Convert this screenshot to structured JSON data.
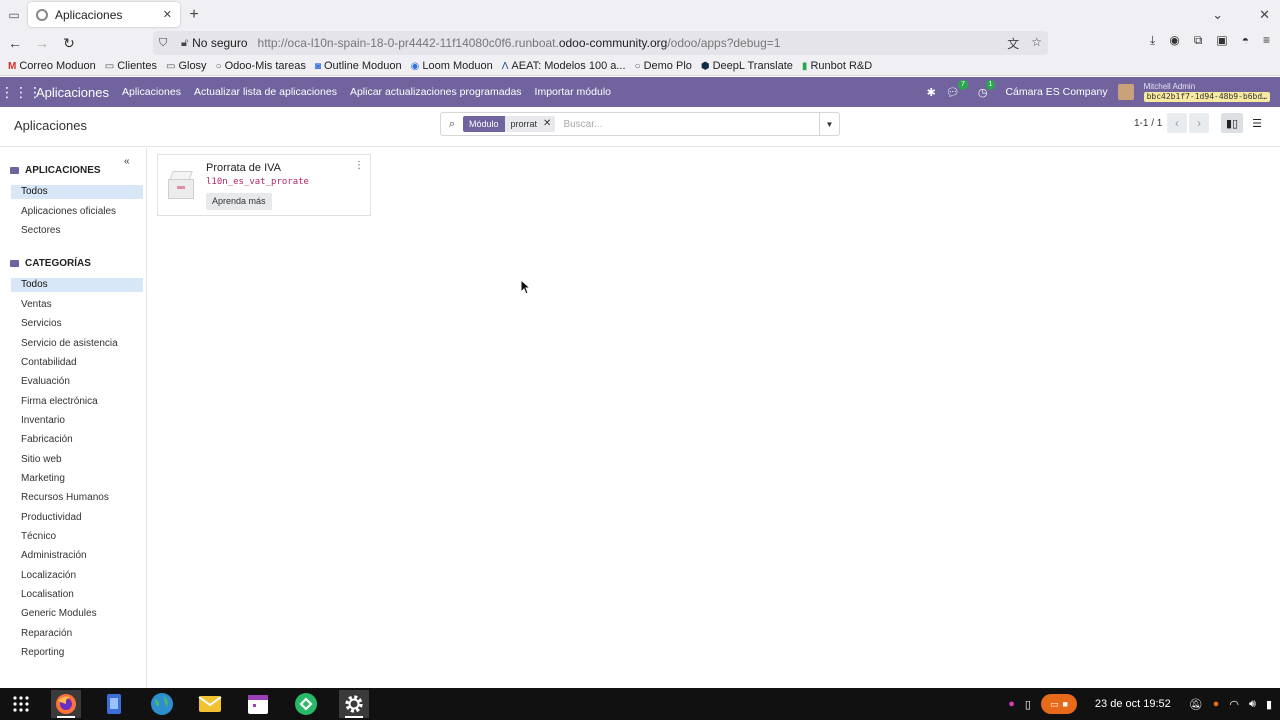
{
  "browser": {
    "tab_title": "Aplicaciones",
    "insecure_label": "No seguro",
    "url_prefix": "http://oca-l10n-spain-18-0-pr4442-11f14080c0f6.runboat.",
    "url_domain": "odoo-community.org",
    "url_suffix": "/odoo/apps?debug=1"
  },
  "bookmarks": [
    {
      "label": "Correo Moduon",
      "icon": "gmail-icon"
    },
    {
      "label": "Clientes",
      "icon": "folder-icon"
    },
    {
      "label": "Glosy",
      "icon": "folder-icon"
    },
    {
      "label": "Odoo-Mis tareas",
      "icon": "odoo-icon"
    },
    {
      "label": "Outline Moduon",
      "icon": "outline-icon"
    },
    {
      "label": "Loom Moduon",
      "icon": "loom-icon"
    },
    {
      "label": "AEAT: Modelos 100 a...",
      "icon": "aeat-icon"
    },
    {
      "label": "Demo Plo",
      "icon": "odoo-icon"
    },
    {
      "label": "DeepL Translate",
      "icon": "deepl-icon"
    },
    {
      "label": "Runbot R&D",
      "icon": "runbot-icon"
    }
  ],
  "odoo_nav": {
    "brand": "Aplicaciones",
    "menu": [
      "Aplicaciones",
      "Actualizar lista de aplicaciones",
      "Aplicar actualizaciones programadas",
      "Importar módulo"
    ],
    "messages_count": "7",
    "activities_count": "1",
    "company": "Cámara ES Company",
    "user": "Mitchell Admin",
    "db": "bbc42b1f7-1d94-48b9-b6bd…"
  },
  "control_panel": {
    "title": "Aplicaciones",
    "facet_key": "Módulo",
    "facet_value": "prorrat",
    "search_placeholder": "Buscar...",
    "pager": "1-1 / 1"
  },
  "sidebar": {
    "apps_header": "APLICACIONES",
    "apps_items": [
      "Todos",
      "Aplicaciones oficiales",
      "Sectores"
    ],
    "categories_header": "CATEGORÍAS",
    "categories": [
      "Todos",
      "Ventas",
      "Servicios",
      "Servicio de asistencia",
      "Contabilidad",
      "Evaluación",
      "Firma electrónica",
      "Inventario",
      "Fabricación",
      "Sitio web",
      "Marketing",
      "Recursos Humanos",
      "Productividad",
      "Técnico",
      "Administración",
      "Localización",
      "Localisation",
      "Generic Modules",
      "Reparación",
      "Reporting"
    ]
  },
  "card": {
    "name": "Prorrata de IVA",
    "technical_name": "l10n_es_vat_prorate",
    "learn_more": "Aprenda más"
  },
  "taskbar": {
    "datetime": "23 de oct  19:52"
  },
  "colors": {
    "odoo_purple": "#71639e",
    "tech_name": "#b3266b",
    "active_filter": "#d7e7f7"
  }
}
